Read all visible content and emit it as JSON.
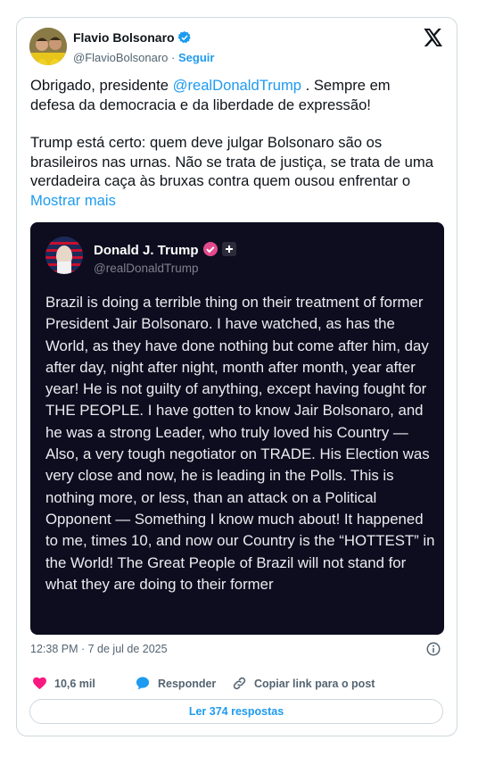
{
  "author": {
    "name": "Flavio Bolsonaro",
    "handle": "@FlavioBolsonaro",
    "separator": "·",
    "follow_label": "Seguir"
  },
  "tweet": {
    "p1_before": "Obrigado, presidente ",
    "p1_mention": "@realDonaldTrump",
    "p1_after": " . Sempre em defesa da democracia e da liberdade de expressão!",
    "p2": "Trump está certo: quem deve julgar Bolsonaro são os brasileiros nas urnas. Não se trata de justiça, se trata de uma verdadeira caça às bruxas contra quem ousou enfrentar o ",
    "show_more": "Mostrar mais"
  },
  "embedded_post": {
    "name": "Donald J. Trump",
    "handle": "@realDonaldTrump",
    "body": "Brazil is doing a terrible thing on their treatment of former President Jair Bolsonaro. I have watched, as has the World, as they have done nothing but come after him, day after day, night after night, month after month, year after year! He is not guilty of anything, except having fought for THE PEOPLE. I have gotten to know Jair Bolsonaro, and he was a strong Leader, who truly loved his Country — Also, a very tough negotiator on TRADE. His Election was very close and now, he is leading in the Polls. This is nothing more, or less, than an attack on a Political Opponent — Something I know much about! It happened to me, times 10, and now our Country is the “HOTTEST” in the World! The Great People of Brazil will not stand for what they are doing to their former"
  },
  "meta": {
    "timestamp": "12:38 PM · 7 de jul de 2025"
  },
  "actions": {
    "likes": "10,6 mil",
    "reply": "Responder",
    "copy_link": "Copiar link para o post"
  },
  "read_replies": "Ler 374 respostas",
  "colors": {
    "accent": "#1d9bf0",
    "like": "#f91880",
    "embedded_bg": "#0d0d1f"
  }
}
